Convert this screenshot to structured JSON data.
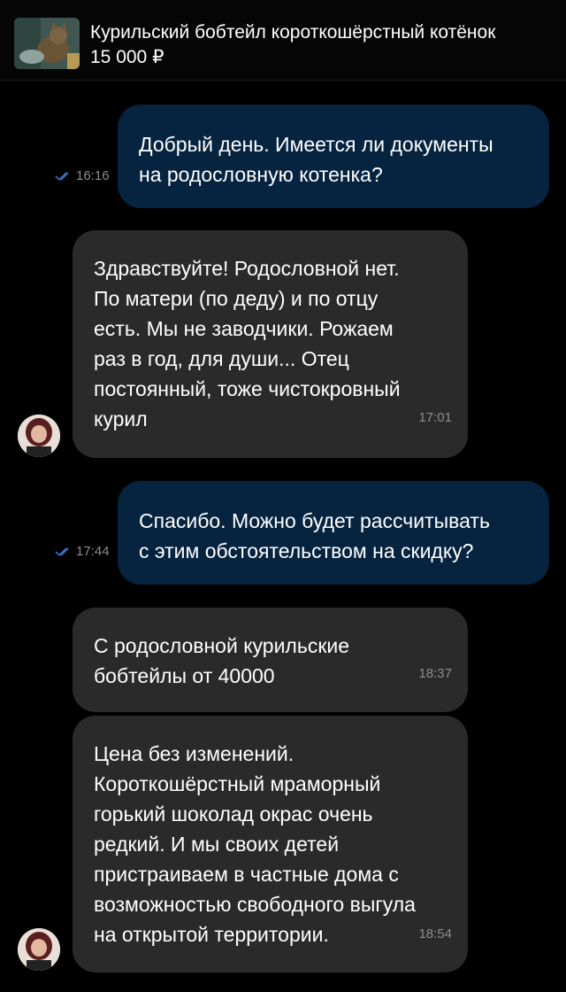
{
  "listing": {
    "title": "Курильский бобтейл короткошёрстный котёнок",
    "price": "15 000 ₽",
    "thumbnail_icon": "kitten-photo"
  },
  "colors": {
    "outgoing_bubble": "#06233f",
    "incoming_bubble": "#2a2a2a",
    "read_check": "#3d6fc9"
  },
  "messages": [
    {
      "direction": "out",
      "text": "Добрый день. Имеется ли документы\nна родословную котенка?",
      "time": "16:16",
      "status_icon": "double-check-icon"
    },
    {
      "direction": "in",
      "text": "Здравствуйте! Родословной нет.\nПо матери (по деду) и по отцу\nесть. Мы не заводчики. Рожаем\nраз в год, для души... Отец\nпостоянный, тоже чистокровный\nкурил",
      "time": "17:01"
    },
    {
      "direction": "out",
      "text": "Спасибо. Можно будет рассчитывать\nс этим обстоятельством на скидку?",
      "time": "17:44",
      "status_icon": "double-check-icon"
    },
    {
      "direction": "in",
      "text": "С родословной курильские\nбобтейлы от 40000",
      "time": "18:37"
    },
    {
      "direction": "in",
      "text": "Цена без изменений.\nКороткошёрстный мраморный\nгорький шоколад окрас очень\nредкий. И мы своих детей\nпристраиваем в частные дома с\nвозможностью свободного выгула\nна открытой территории.",
      "time": "18:54"
    }
  ]
}
